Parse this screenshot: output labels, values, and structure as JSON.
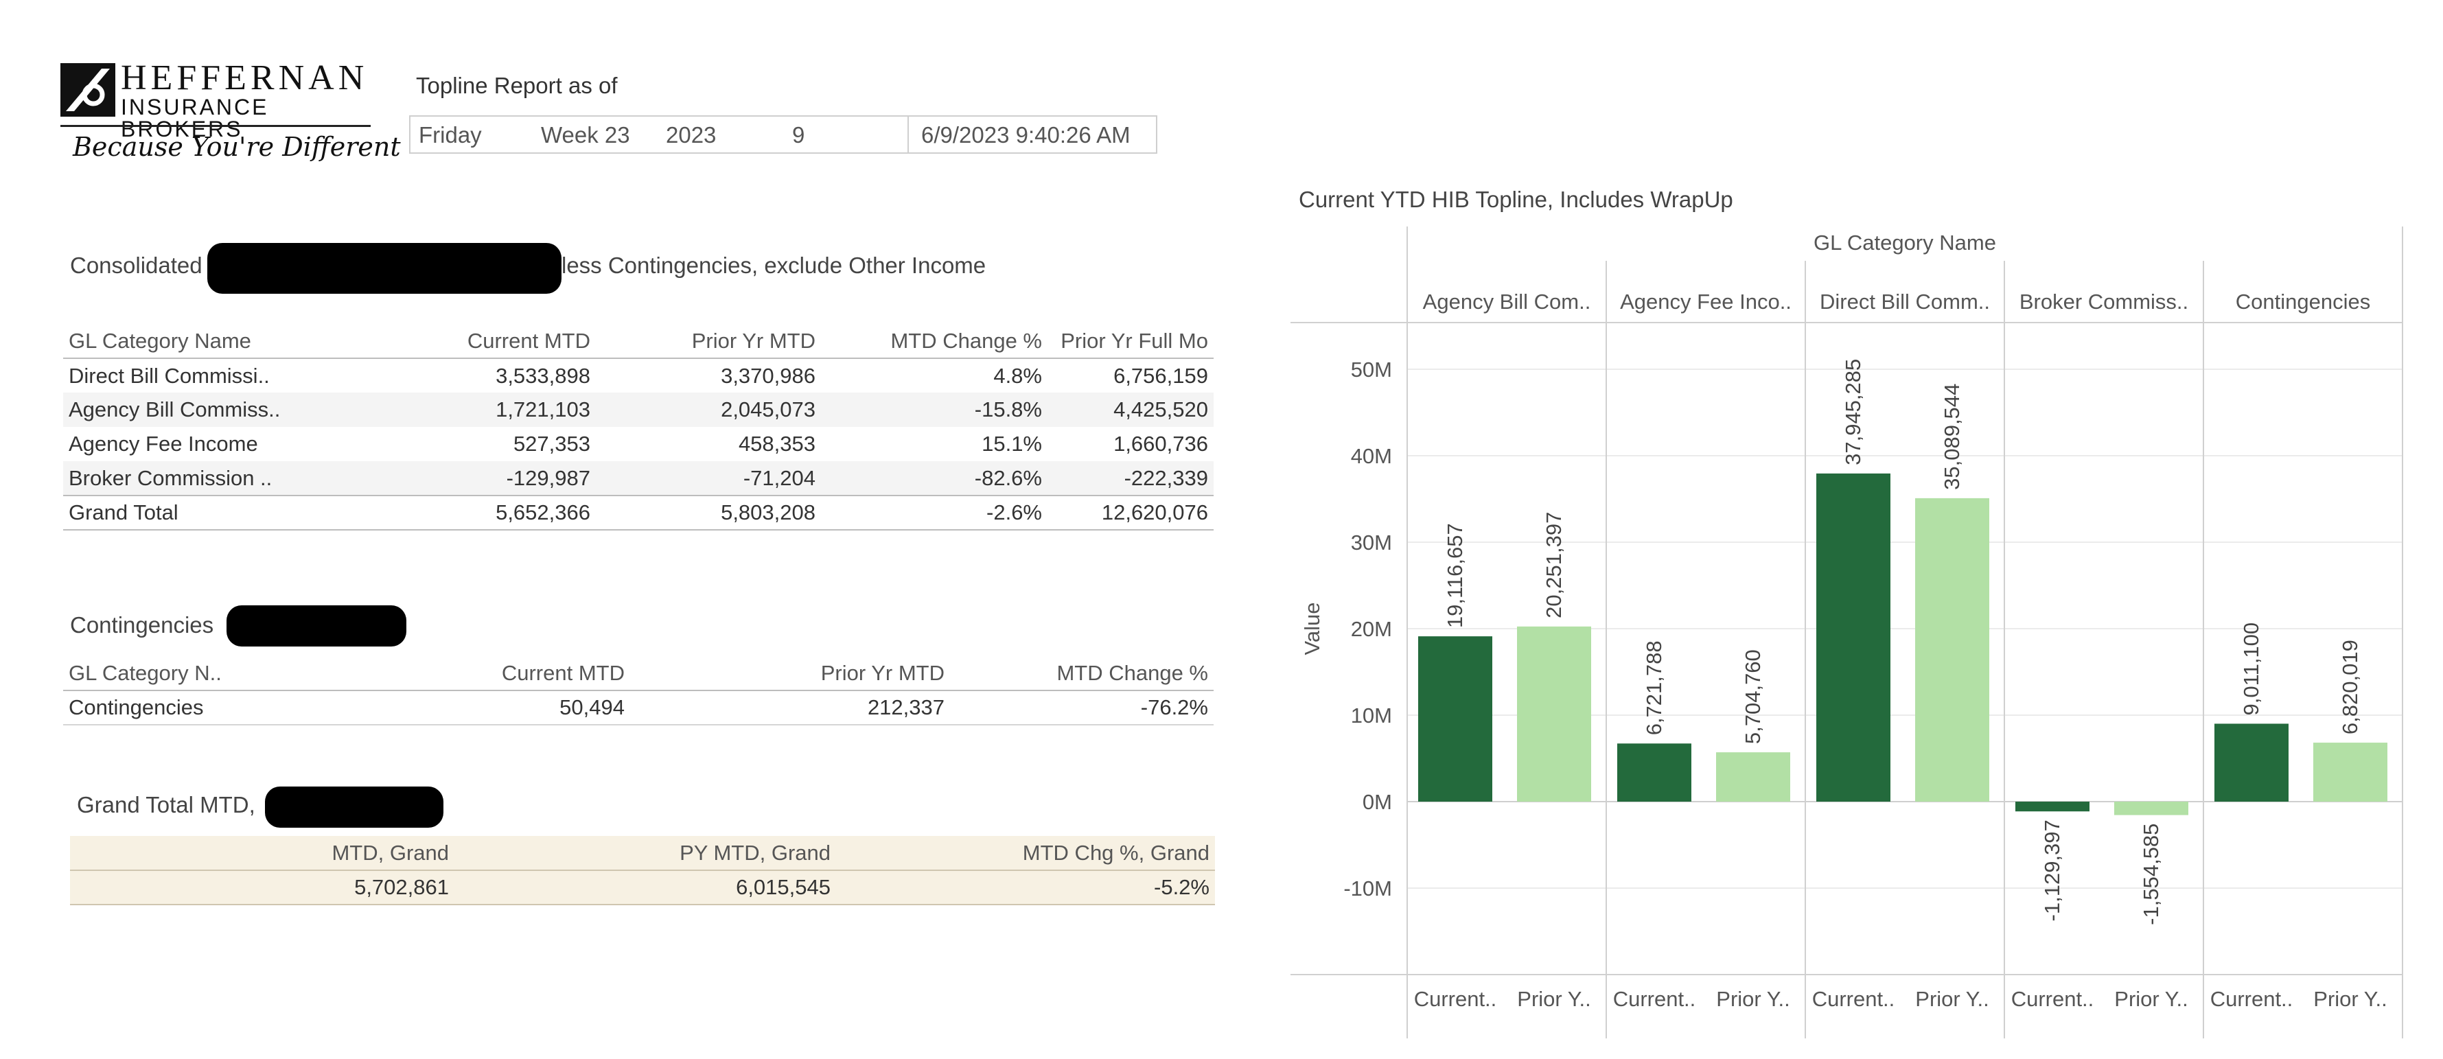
{
  "logo": {
    "name": "HEFFERNAN",
    "subtitle": "INSURANCE BROKERS",
    "tagline": "Because You're Different"
  },
  "report": {
    "title": "Topline Report as of",
    "day": "Friday",
    "week": "Week 23",
    "year": "2023",
    "month": "9",
    "timestamp": "6/9/2023 9:40:26 AM"
  },
  "consolidated": {
    "title_prefix": "Consolidated",
    "title_suffix": "less Contingencies, exclude Other Income",
    "headers": [
      "GL Category Name",
      "Current MTD",
      "Prior Yr MTD",
      "MTD Change %",
      "Prior Yr Full Mo"
    ],
    "rows": [
      [
        "Direct Bill Commissi..",
        "3,533,898",
        "3,370,986",
        "4.8%",
        "6,756,159"
      ],
      [
        "Agency Bill Commiss..",
        "1,721,103",
        "2,045,073",
        "-15.8%",
        "4,425,520"
      ],
      [
        "Agency Fee Income",
        "527,353",
        "458,353",
        "15.1%",
        "1,660,736"
      ],
      [
        "Broker Commission ..",
        "-129,987",
        "-71,204",
        "-82.6%",
        "-222,339"
      ]
    ],
    "total": [
      "Grand Total",
      "5,652,366",
      "5,803,208",
      "-2.6%",
      "12,620,076"
    ]
  },
  "contingencies": {
    "title": "Contingencies",
    "headers": [
      "GL Category N..",
      "Current MTD",
      "Prior Yr MTD",
      "MTD Change %"
    ],
    "rows": [
      [
        "Contingencies",
        "50,494",
        "212,337",
        "-76.2%"
      ]
    ]
  },
  "grand_total": {
    "title": "Grand Total MTD,",
    "headers": [
      "MTD, Grand",
      "PY MTD, Grand",
      "MTD Chg %, Grand"
    ],
    "values": [
      "5,702,861",
      "6,015,545",
      "-5.2%"
    ]
  },
  "colors": {
    "current": "#236a3c",
    "prior": "#b2e0a5",
    "grand_bg": "#f7f1e3",
    "gridline": "#ebebeb",
    "divider": "#d0d0d0"
  },
  "chart_data": {
    "type": "bar",
    "title": "Current YTD HIB Topline, Includes WrapUp",
    "column_header": "GL Category Name",
    "ylabel": "Value",
    "ylim": [
      -20000000,
      50000000
    ],
    "y_ticks": [
      {
        "value": 50000000,
        "label": "50M"
      },
      {
        "value": 40000000,
        "label": "40M"
      },
      {
        "value": 30000000,
        "label": "30M"
      },
      {
        "value": 20000000,
        "label": "20M"
      },
      {
        "value": 10000000,
        "label": "10M"
      },
      {
        "value": 0,
        "label": "0M"
      },
      {
        "value": -10000000,
        "label": "-10M"
      }
    ],
    "x_labels": [
      "Current..",
      "Prior Y.."
    ],
    "categories": [
      {
        "name": "Agency Bill Com..",
        "values": [
          {
            "value": 19116657,
            "label": "19,116,657"
          },
          {
            "value": 20251397,
            "label": "20,251,397"
          }
        ]
      },
      {
        "name": "Agency Fee Inco..",
        "values": [
          {
            "value": 6721788,
            "label": "6,721,788"
          },
          {
            "value": 5704760,
            "label": "5,704,760"
          }
        ]
      },
      {
        "name": "Direct Bill Comm..",
        "values": [
          {
            "value": 37945285,
            "label": "37,945,285"
          },
          {
            "value": 35089544,
            "label": "35,089,544"
          }
        ]
      },
      {
        "name": "Broker Commiss..",
        "values": [
          {
            "value": -1129397,
            "label": "-1,129,397"
          },
          {
            "value": -1554585,
            "label": "-1,554,585"
          }
        ]
      },
      {
        "name": "Contingencies",
        "values": [
          {
            "value": 9011100,
            "label": "9,011,100"
          },
          {
            "value": 6820019,
            "label": "6,820,019"
          }
        ]
      }
    ]
  }
}
